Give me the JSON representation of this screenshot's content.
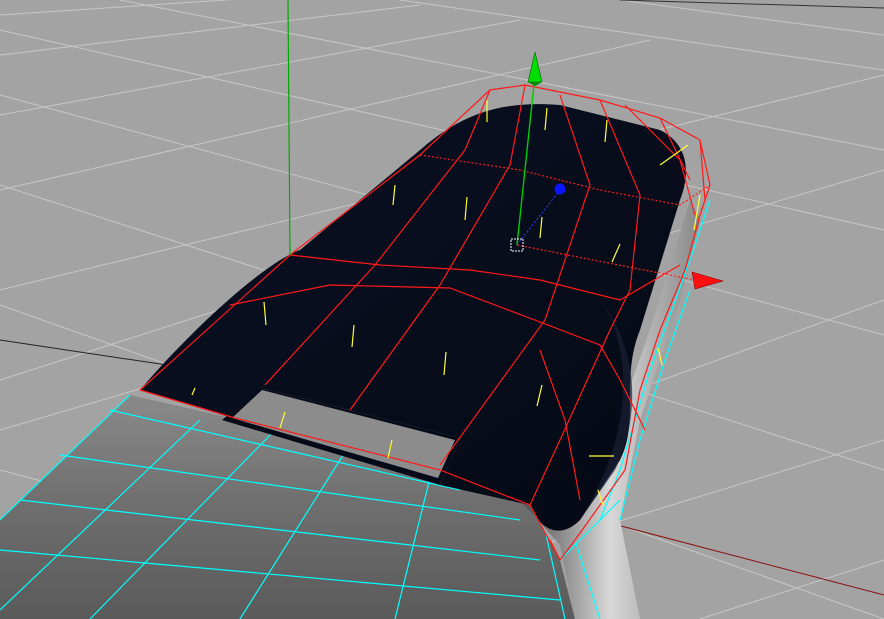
{
  "viewport": {
    "view": "perspective",
    "background_color": "#a3a3a3",
    "grid_color": "#cfcfcf",
    "selection_color": "#ff0000",
    "wireframe_color": "#00ffff",
    "normal_color": "#ffff00",
    "roof_color": "#0a1020",
    "axis_y_color": "#00aa00",
    "axis_x_color": "#ff0000",
    "axis_z_color": "#0000ff"
  },
  "scene": {
    "object": "car-roof-mesh",
    "tool": "move-manipulator",
    "selection": "roof-faces"
  }
}
